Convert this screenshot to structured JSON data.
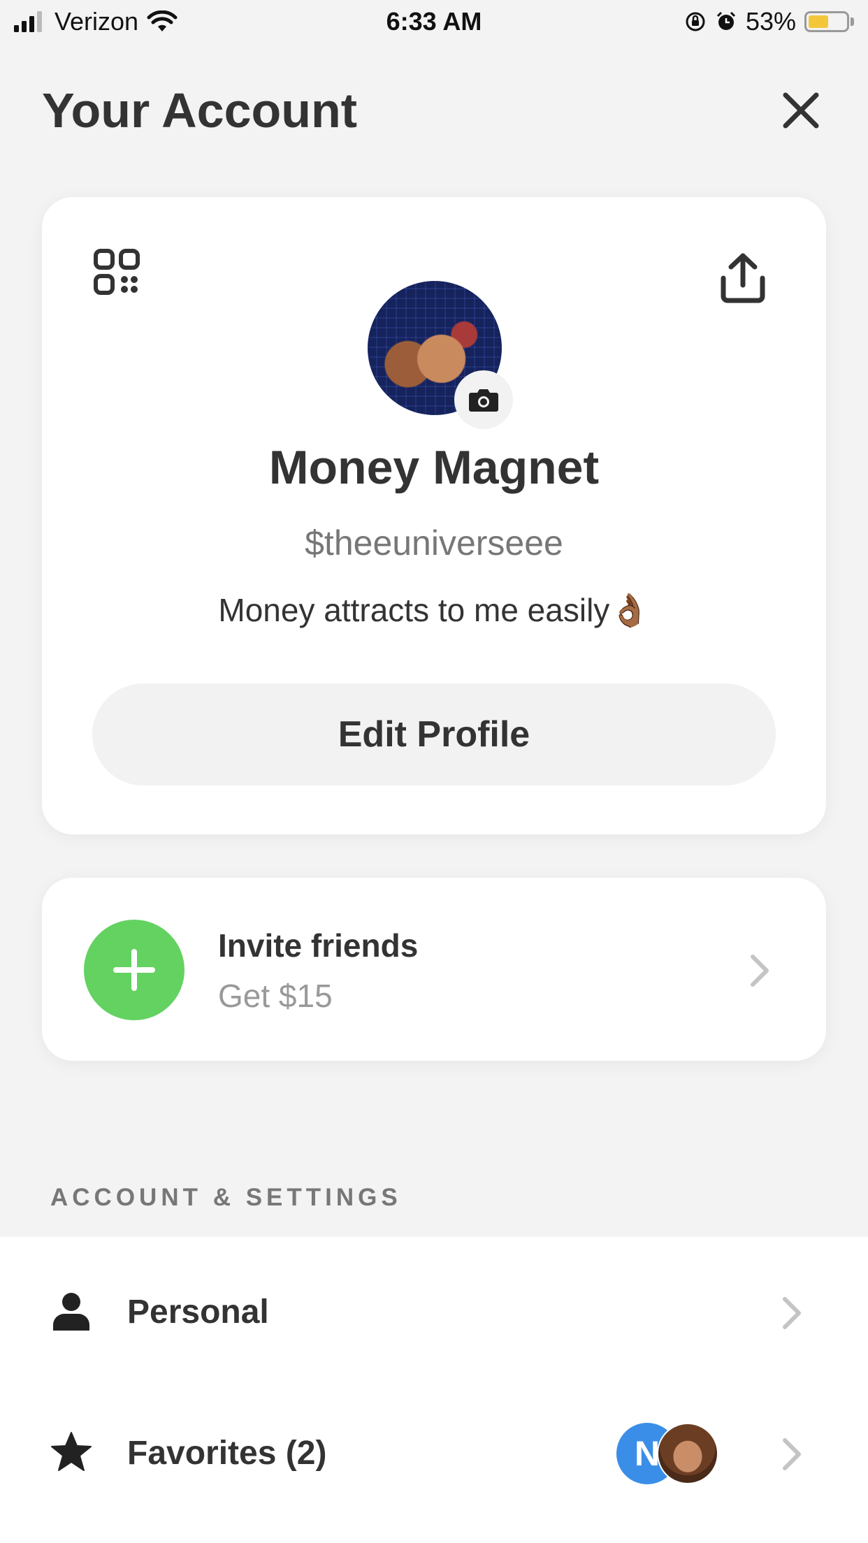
{
  "status_bar": {
    "carrier": "Verizon",
    "time": "6:33 AM",
    "battery": "53%",
    "battery_level": 0.53
  },
  "header": {
    "title": "Your Account"
  },
  "profile": {
    "display_name": "Money Magnet",
    "cashtag": "$theeuniverseee",
    "bio": "Money attracts to me easily👌🏾",
    "edit_button": "Edit Profile"
  },
  "invite": {
    "title": "Invite friends",
    "subtitle": "Get $15",
    "icon_color": "#63d261"
  },
  "settings": {
    "section_label": "ACCOUNT & SETTINGS",
    "items": [
      {
        "label": "Personal",
        "icon": "person-icon"
      },
      {
        "label": "Favorites (2)",
        "icon": "star-icon",
        "avatar_initial": "N"
      }
    ]
  },
  "colors": {
    "background": "#f3f3f3",
    "card": "#ffffff",
    "accent_green": "#63d261",
    "favorite_blue": "#3b8ee8"
  }
}
